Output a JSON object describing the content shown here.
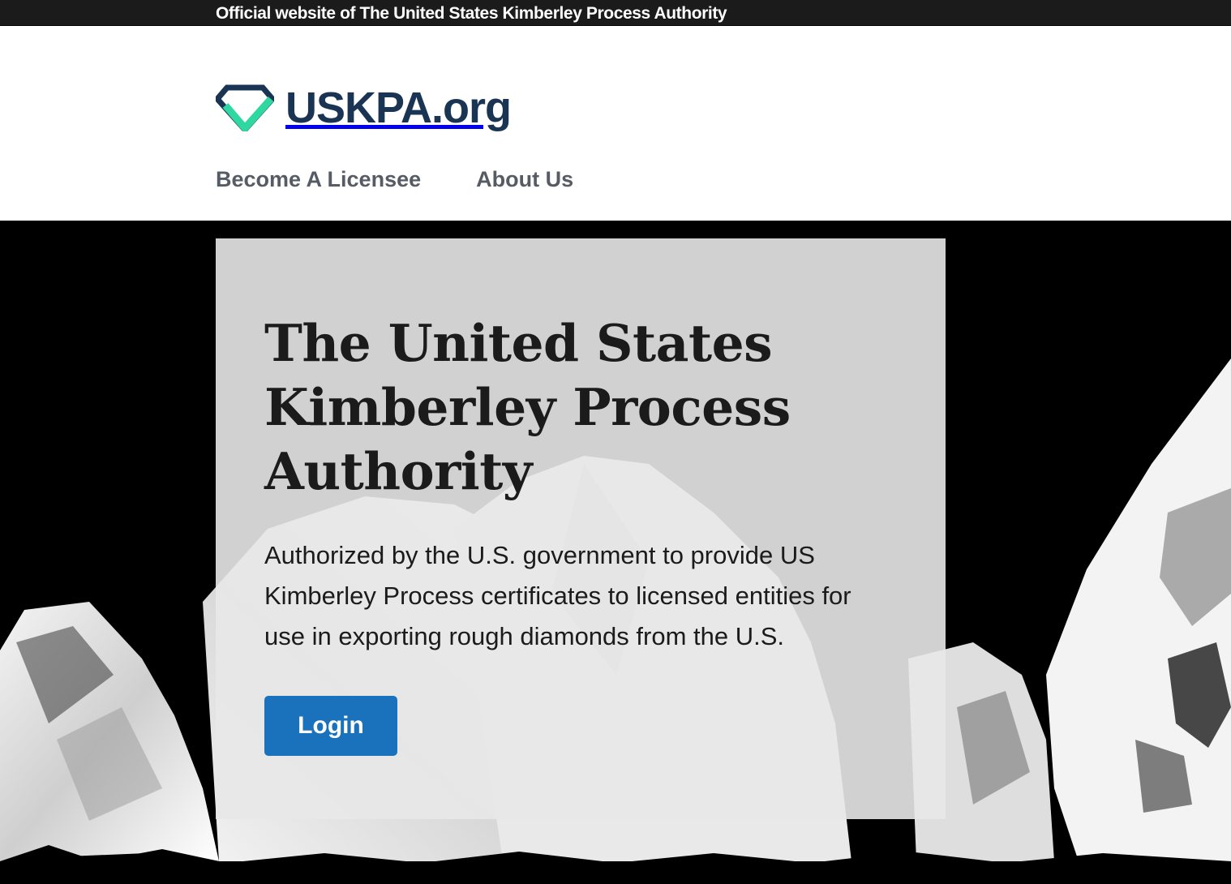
{
  "banner": {
    "text": "Official website of The United States Kimberley Process Authority"
  },
  "header": {
    "logo_text": "USKPA.org",
    "logo_icon": "diamond-logo-icon",
    "nav": [
      {
        "label": "Become A Licensee"
      },
      {
        "label": "About Us"
      }
    ]
  },
  "hero": {
    "title": "The United States Kimberley Process Authority",
    "description": "Authorized by the U.S. government to provide US Kimberley Process certificates to licensed entities for use in exporting rough diamonds from the U.S.",
    "login_label": "Login"
  },
  "colors": {
    "brand_navy": "#1a3453",
    "brand_green": "#2fd8a0",
    "button_blue": "#1a72bd",
    "banner_bg": "#1b1b1b",
    "nav_text": "#565c65"
  }
}
